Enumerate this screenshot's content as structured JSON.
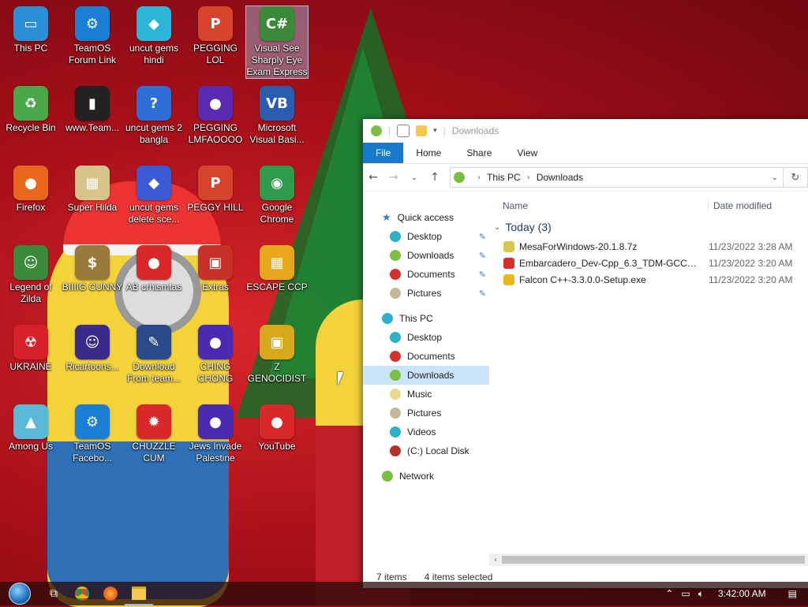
{
  "desktop_icons": [
    {
      "label": "This PC",
      "icon": "computer-icon",
      "color": "#2a8fd6",
      "glyph": "▭"
    },
    {
      "label": "TeamOS Forum Link",
      "icon": "gear-icon",
      "color": "#1a7fd4",
      "glyph": "⚙"
    },
    {
      "label": "uncut gems hindi",
      "icon": "diamond-icon",
      "color": "#2bb5d8",
      "glyph": "◆"
    },
    {
      "label": "PEGGING LOL",
      "icon": "p-logo-icon",
      "color": "#d8432b",
      "glyph": "P"
    },
    {
      "label": "Visual See Sharply Eye Exam Express",
      "icon": "csharp-icon",
      "color": "#3a8a3a",
      "glyph": "C#"
    },
    {
      "label": "Recycle Bin",
      "icon": "recycle-bin-icon",
      "color": "#4aa84a",
      "glyph": "♻"
    },
    {
      "label": "www.Team...",
      "icon": "file-icon",
      "color": "#222222",
      "glyph": "▮"
    },
    {
      "label": "uncut gems 2 bangla",
      "icon": "question-icon",
      "color": "#2d6fd6",
      "glyph": "?"
    },
    {
      "label": "PEGGING LMFAOOOO",
      "icon": "orb-icon",
      "color": "#5a2ab0",
      "glyph": "●"
    },
    {
      "label": "Microsoft Visual Basi...",
      "icon": "vb-icon",
      "color": "#2a5cb0",
      "glyph": "VB"
    },
    {
      "label": "Firefox",
      "icon": "firefox-icon",
      "color": "#e8671c",
      "glyph": "●"
    },
    {
      "label": "Super Hilda",
      "icon": "pixel-art-icon",
      "color": "#d8c48a",
      "glyph": "▦"
    },
    {
      "label": "uncut gems delete sce...",
      "icon": "gem-icon",
      "color": "#3a5ad6",
      "glyph": "◆"
    },
    {
      "label": "PEGGY HILL",
      "icon": "p-logo-icon",
      "color": "#d8432b",
      "glyph": "P"
    },
    {
      "label": "Google Chrome",
      "icon": "chrome-icon",
      "color": "#2e9c4c",
      "glyph": "◉"
    },
    {
      "label": "Legend of Zilda",
      "icon": "game-character-icon",
      "color": "#3a8a3a",
      "glyph": "☺"
    },
    {
      "label": "BIIIIG CUNNY",
      "icon": "money-bag-icon",
      "color": "#9a7a3a",
      "glyph": "$"
    },
    {
      "label": "AB crhismtas",
      "icon": "angry-bird-icon",
      "color": "#d8282a",
      "glyph": "●"
    },
    {
      "label": "Extras",
      "icon": "extras-icon",
      "color": "#c8302a",
      "glyph": "▣"
    },
    {
      "label": "ESCAPE CCP",
      "icon": "mahjong-icon",
      "color": "#e8a81c",
      "glyph": "▦"
    },
    {
      "label": "UKRAINE",
      "icon": "radiation-icon",
      "color": "#d8202a",
      "glyph": "☢"
    },
    {
      "label": "Ricartoons...",
      "icon": "cartoon-icon",
      "color": "#3a2a8a",
      "glyph": "☺"
    },
    {
      "label": "Download From team...",
      "icon": "download-icon",
      "color": "#2a4a8a",
      "glyph": "✎"
    },
    {
      "label": "CHING CHONG",
      "icon": "orb-icon",
      "color": "#4a2ab0",
      "glyph": "●"
    },
    {
      "label": "Z GENOCIDIST",
      "icon": "gift-icon",
      "color": "#d8a81c",
      "glyph": "▣"
    },
    {
      "label": "Among Us",
      "icon": "among-us-icon",
      "color": "#5ab8d8",
      "glyph": "▲"
    },
    {
      "label": "TeamOS Facebo...",
      "icon": "gear-icon",
      "color": "#1a7fd4",
      "glyph": "⚙"
    },
    {
      "label": "CHUZZLE CUM",
      "icon": "fuzzball-icon",
      "color": "#d8282a",
      "glyph": "✹"
    },
    {
      "label": "Jews Invade Palestine",
      "icon": "orb-icon",
      "color": "#4a2ab0",
      "glyph": "●"
    },
    {
      "label": "YouTube",
      "icon": "angry-bird-icon",
      "color": "#d8282a",
      "glyph": "●"
    }
  ],
  "explorer": {
    "title": "Downloads",
    "ribbon_tabs": [
      "File",
      "Home",
      "Share",
      "View"
    ],
    "address": {
      "root": "This PC",
      "current": "Downloads"
    },
    "nav": {
      "quick_access": "Quick access",
      "quick_items": [
        {
          "label": "Desktop",
          "color": "#2ab0c8",
          "pinned": true
        },
        {
          "label": "Downloads",
          "color": "#7bc043",
          "pinned": true
        },
        {
          "label": "Documents",
          "color": "#d8302a",
          "pinned": true
        },
        {
          "label": "Pictures",
          "color": "#c8b89a",
          "pinned": true
        }
      ],
      "this_pc": "This PC",
      "pc_items": [
        {
          "label": "Desktop",
          "color": "#2ab0c8"
        },
        {
          "label": "Documents",
          "color": "#d8302a"
        },
        {
          "label": "Downloads",
          "color": "#7bc043"
        },
        {
          "label": "Music",
          "color": "#e8d890"
        },
        {
          "label": "Pictures",
          "color": "#c8b89a"
        },
        {
          "label": "Videos",
          "color": "#2ab0c8"
        },
        {
          "label": "(C:) Local Disk",
          "color": "#b8302a"
        }
      ],
      "network": "Network"
    },
    "columns": {
      "name": "Name",
      "date": "Date modified"
    },
    "group": "Today (3)",
    "files": [
      {
        "name": "MesaForWindows-20.1.8.7z",
        "date": "11/23/2022 3:28 AM",
        "color": "#d8c84a"
      },
      {
        "name": "Embarcadero_Dev-Cpp_6.3_TDM-GCC_9....",
        "date": "11/23/2022 3:20 AM",
        "color": "#d8302a"
      },
      {
        "name": "Falcon C++-3.3.0.0-Setup.exe",
        "date": "11/23/2022 3:20 AM",
        "color": "#e8b81c"
      }
    ],
    "status": {
      "items": "7 items",
      "selected": "4 items selected"
    }
  },
  "taskbar": {
    "clock": "3:42:00 AM"
  }
}
